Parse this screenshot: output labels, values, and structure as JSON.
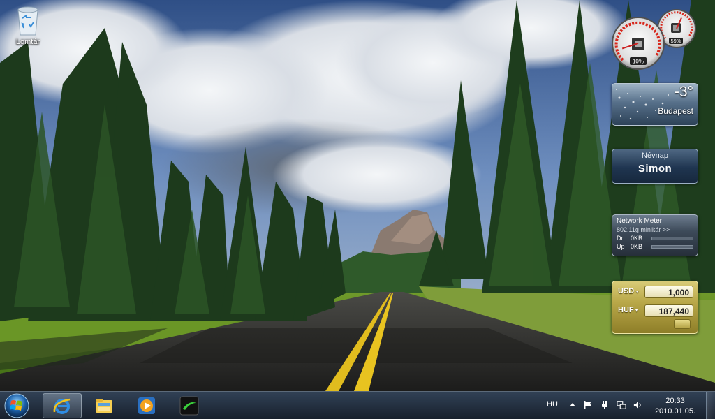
{
  "desktop": {
    "recycle_bin": {
      "label": "Lomtár",
      "icon": "recycle-bin-icon"
    }
  },
  "gadgets": {
    "cpu_meter": {
      "cpu_percent": 10,
      "cpu_label": "10%",
      "memory_percent": 59,
      "memory_label": "59%"
    },
    "weather": {
      "temperature": "-3°",
      "city": "Budapest"
    },
    "nevnap": {
      "title": "Névnap",
      "name": "Simon"
    },
    "network_meter": {
      "title": "Network Meter",
      "subtitle": "802.11g minikár >>",
      "rows": [
        {
          "label": "Dn",
          "value": "0KB"
        },
        {
          "label": "Up",
          "value": "0KB"
        }
      ]
    },
    "currency": {
      "from_code": "USD",
      "from_value": "1,000",
      "to_code": "HUF",
      "to_value": "187,440"
    }
  },
  "taskbar": {
    "pinned": [
      {
        "name": "internet-explorer-icon",
        "active": true
      },
      {
        "name": "windows-explorer-icon",
        "active": false
      },
      {
        "name": "media-player-icon",
        "active": false
      },
      {
        "name": "app-icon",
        "active": false
      }
    ],
    "tray": {
      "language": "HU",
      "time": "20:33",
      "date": "2010.01.05."
    }
  },
  "colors": {
    "taskbar": "#1c2530",
    "currency_gadget": "#b9a849",
    "gauge_red": "#d8261b"
  }
}
